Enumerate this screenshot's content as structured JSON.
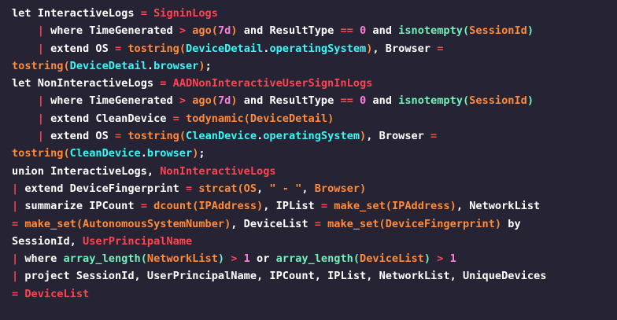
{
  "editor": {
    "colors": {
      "background": "#262335",
      "plain": "#ffffff",
      "pink": "#fe4450",
      "orange": "#ff8b39",
      "magenta": "#ff7edb",
      "cyan": "#36f9f6",
      "green": "#72f1b8"
    },
    "lines": [
      [
        [
          "t-kw",
          "let "
        ],
        [
          "t-ident",
          "InteractiveLogs"
        ],
        [
          "t-pink",
          " = "
        ],
        [
          "t-pink",
          "SigninLogs"
        ]
      ],
      [
        [
          "t-plain",
          "    "
        ],
        [
          "t-pink",
          "| "
        ],
        [
          "t-kw",
          "where "
        ],
        [
          "t-ident",
          "TimeGenerated"
        ],
        [
          "t-pink",
          " > "
        ],
        [
          "t-orange",
          "ago("
        ],
        [
          "t-magenta",
          "7d"
        ],
        [
          "t-orange",
          ")"
        ],
        [
          "t-plain",
          " and "
        ],
        [
          "t-ident",
          "ResultType"
        ],
        [
          "t-pink",
          " == "
        ],
        [
          "t-magenta",
          "0"
        ],
        [
          "t-plain",
          " and "
        ],
        [
          "t-green",
          "isnotempty("
        ],
        [
          "t-orange",
          "SessionId"
        ],
        [
          "t-green",
          ")"
        ]
      ],
      [
        [
          "t-plain",
          "    "
        ],
        [
          "t-pink",
          "| "
        ],
        [
          "t-kw",
          "extend "
        ],
        [
          "t-ident",
          "OS"
        ],
        [
          "t-pink",
          " = "
        ],
        [
          "t-orange",
          "tostring("
        ],
        [
          "t-cyan",
          "DeviceDetail"
        ],
        [
          "t-plain",
          "."
        ],
        [
          "t-cyan",
          "operatingSystem"
        ],
        [
          "t-orange",
          ")"
        ],
        [
          "t-plain",
          ", "
        ],
        [
          "t-ident",
          "Browser"
        ],
        [
          "t-pink",
          " ="
        ]
      ],
      [
        [
          "t-orange",
          "tostring("
        ],
        [
          "t-cyan",
          "DeviceDetail"
        ],
        [
          "t-plain",
          "."
        ],
        [
          "t-cyan",
          "browser"
        ],
        [
          "t-orange",
          ")"
        ],
        [
          "t-plain",
          ";"
        ]
      ],
      [
        [
          "t-kw",
          "let "
        ],
        [
          "t-ident",
          "NonInteractiveLogs"
        ],
        [
          "t-pink",
          " = "
        ],
        [
          "t-pink",
          "AADNonInteractiveUserSignInLogs"
        ]
      ],
      [
        [
          "t-plain",
          "    "
        ],
        [
          "t-pink",
          "| "
        ],
        [
          "t-kw",
          "where "
        ],
        [
          "t-ident",
          "TimeGenerated"
        ],
        [
          "t-pink",
          " > "
        ],
        [
          "t-orange",
          "ago("
        ],
        [
          "t-magenta",
          "7d"
        ],
        [
          "t-orange",
          ")"
        ],
        [
          "t-plain",
          " and "
        ],
        [
          "t-ident",
          "ResultType"
        ],
        [
          "t-pink",
          " == "
        ],
        [
          "t-magenta",
          "0"
        ],
        [
          "t-plain",
          " and "
        ],
        [
          "t-green",
          "isnotempty("
        ],
        [
          "t-orange",
          "SessionId"
        ],
        [
          "t-green",
          ")"
        ]
      ],
      [
        [
          "t-plain",
          "    "
        ],
        [
          "t-pink",
          "| "
        ],
        [
          "t-kw",
          "extend "
        ],
        [
          "t-ident",
          "CleanDevice"
        ],
        [
          "t-pink",
          " = "
        ],
        [
          "t-orange",
          "todynamic("
        ],
        [
          "t-orange",
          "DeviceDetail"
        ],
        [
          "t-orange",
          ")"
        ]
      ],
      [
        [
          "t-plain",
          "    "
        ],
        [
          "t-pink",
          "| "
        ],
        [
          "t-kw",
          "extend "
        ],
        [
          "t-ident",
          "OS"
        ],
        [
          "t-pink",
          " = "
        ],
        [
          "t-orange",
          "tostring("
        ],
        [
          "t-cyan",
          "CleanDevice"
        ],
        [
          "t-plain",
          "."
        ],
        [
          "t-cyan",
          "operatingSystem"
        ],
        [
          "t-orange",
          ")"
        ],
        [
          "t-plain",
          ", "
        ],
        [
          "t-ident",
          "Browser"
        ],
        [
          "t-pink",
          " ="
        ]
      ],
      [
        [
          "t-orange",
          "tostring("
        ],
        [
          "t-cyan",
          "CleanDevice"
        ],
        [
          "t-plain",
          "."
        ],
        [
          "t-cyan",
          "browser"
        ],
        [
          "t-orange",
          ")"
        ],
        [
          "t-plain",
          ";"
        ]
      ],
      [
        [
          "t-kw",
          "union "
        ],
        [
          "t-ident",
          "InteractiveLogs"
        ],
        [
          "t-plain",
          ", "
        ],
        [
          "t-pink",
          "NonInteractiveLogs"
        ]
      ],
      [
        [
          "t-pink",
          "| "
        ],
        [
          "t-kw",
          "extend "
        ],
        [
          "t-ident",
          "DeviceFingerprint"
        ],
        [
          "t-pink",
          " = "
        ],
        [
          "t-orange",
          "strcat("
        ],
        [
          "t-orange",
          "OS"
        ],
        [
          "t-plain",
          ", "
        ],
        [
          "t-orange",
          "\" - \""
        ],
        [
          "t-plain",
          ", "
        ],
        [
          "t-orange",
          "Browser"
        ],
        [
          "t-orange",
          ")"
        ]
      ],
      [
        [
          "t-pink",
          "| "
        ],
        [
          "t-kw",
          "summarize "
        ],
        [
          "t-ident",
          "IPCount"
        ],
        [
          "t-pink",
          " = "
        ],
        [
          "t-orange",
          "dcount("
        ],
        [
          "t-orange",
          "IPAddress"
        ],
        [
          "t-orange",
          ")"
        ],
        [
          "t-plain",
          ", "
        ],
        [
          "t-ident",
          "IPList"
        ],
        [
          "t-pink",
          " = "
        ],
        [
          "t-orange",
          "make_set("
        ],
        [
          "t-orange",
          "IPAddress"
        ],
        [
          "t-orange",
          ")"
        ],
        [
          "t-plain",
          ", "
        ],
        [
          "t-ident",
          "NetworkList"
        ]
      ],
      [
        [
          "t-pink",
          "= "
        ],
        [
          "t-orange",
          "make_set("
        ],
        [
          "t-orange",
          "AutonomousSystemNumber"
        ],
        [
          "t-orange",
          ")"
        ],
        [
          "t-plain",
          ", "
        ],
        [
          "t-ident",
          "DeviceList"
        ],
        [
          "t-pink",
          " = "
        ],
        [
          "t-orange",
          "make_set("
        ],
        [
          "t-orange",
          "DeviceFingerprint"
        ],
        [
          "t-orange",
          ")"
        ],
        [
          "t-plain",
          " by"
        ]
      ],
      [
        [
          "t-ident",
          "SessionId"
        ],
        [
          "t-plain",
          ", "
        ],
        [
          "t-pink",
          "UserPrincipalName"
        ]
      ],
      [
        [
          "t-pink",
          "| "
        ],
        [
          "t-kw",
          "where "
        ],
        [
          "t-green",
          "array_length("
        ],
        [
          "t-orange",
          "NetworkList"
        ],
        [
          "t-green",
          ")"
        ],
        [
          "t-pink",
          " > "
        ],
        [
          "t-magenta",
          "1"
        ],
        [
          "t-plain",
          " or "
        ],
        [
          "t-green",
          "array_length("
        ],
        [
          "t-orange",
          "DeviceList"
        ],
        [
          "t-green",
          ")"
        ],
        [
          "t-pink",
          " > "
        ],
        [
          "t-magenta",
          "1"
        ]
      ],
      [
        [
          "t-pink",
          "| "
        ],
        [
          "t-kw",
          "project "
        ],
        [
          "t-ident",
          "SessionId"
        ],
        [
          "t-plain",
          ", "
        ],
        [
          "t-ident",
          "UserPrincipalName"
        ],
        [
          "t-plain",
          ", "
        ],
        [
          "t-ident",
          "IPCount"
        ],
        [
          "t-plain",
          ", "
        ],
        [
          "t-ident",
          "IPList"
        ],
        [
          "t-plain",
          ", "
        ],
        [
          "t-ident",
          "NetworkList"
        ],
        [
          "t-plain",
          ", "
        ],
        [
          "t-ident",
          "UniqueDevices"
        ]
      ],
      [
        [
          "t-pink",
          "= "
        ],
        [
          "t-pink",
          "DeviceList"
        ]
      ]
    ]
  }
}
